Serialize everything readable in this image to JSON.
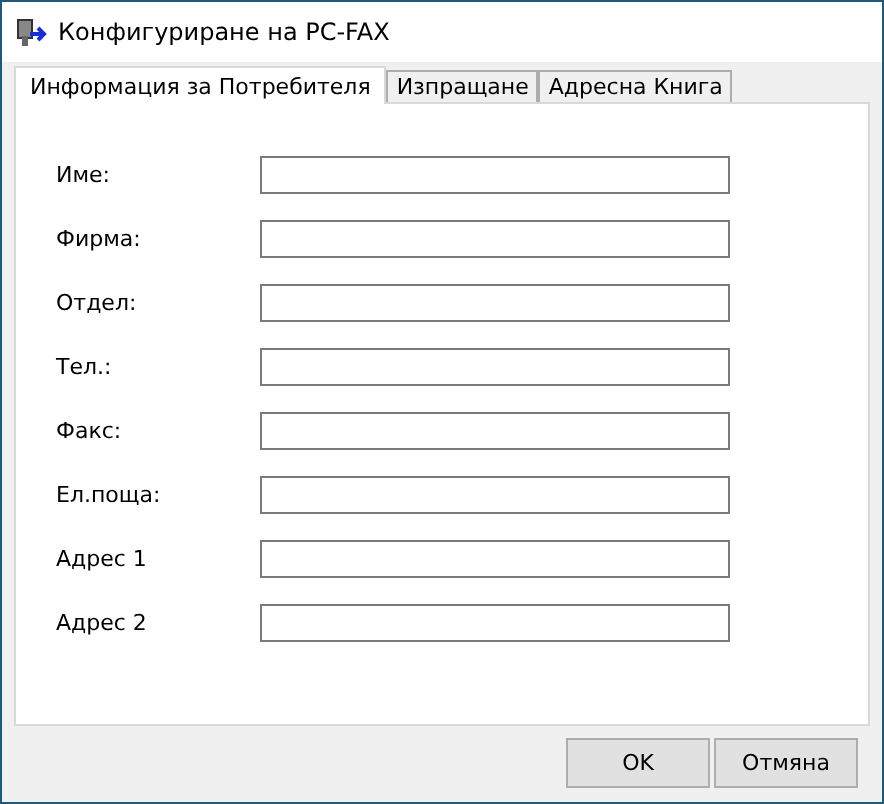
{
  "window": {
    "title": "Конфигуриране на PC-FAX"
  },
  "tabs": [
    {
      "label": "Информация за Потребителя",
      "selected": true
    },
    {
      "label": "Изпращане",
      "selected": false
    },
    {
      "label": "Адресна Книга",
      "selected": false
    }
  ],
  "fields": [
    {
      "label": "Име:"
    },
    {
      "label": "Фирма:"
    },
    {
      "label": "Отдел:"
    },
    {
      "label": "Тел.:"
    },
    {
      "label": "Факс:"
    },
    {
      "label": "Ел.поща:"
    },
    {
      "label": "Адрес 1"
    },
    {
      "label": "Адрес 2"
    }
  ],
  "buttons": [
    "OK",
    "Отмяна"
  ]
}
